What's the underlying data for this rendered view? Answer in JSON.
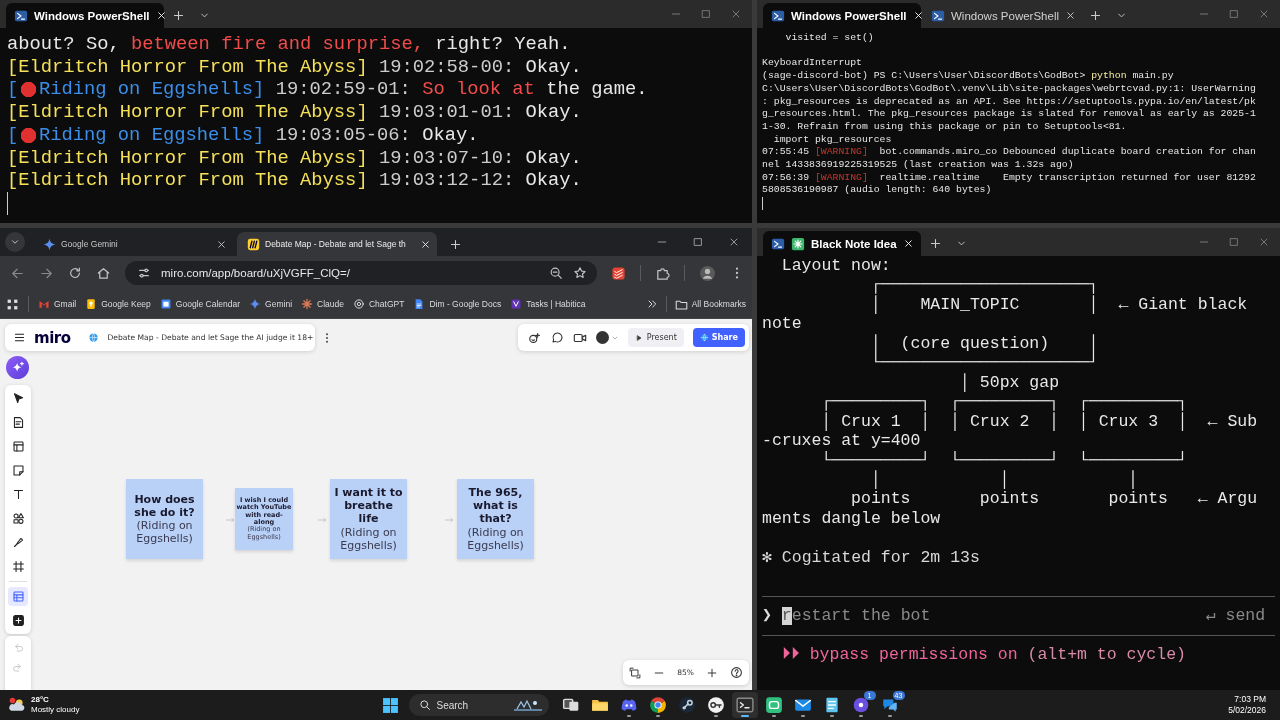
{
  "terminal_left": {
    "tabs": [
      {
        "kind": "shell",
        "label": "Windows PowerShell",
        "selected": true
      }
    ],
    "lines": [
      {
        "segments": [
          {
            "kind": "plain",
            "text": "about? So, "
          },
          {
            "kind": "alert",
            "text": "between fire and surprise,"
          },
          {
            "kind": "plain",
            "text": " right? Yeah."
          }
        ]
      },
      {
        "segments": [
          {
            "kind": "name_a",
            "text": "[Eldritch Horror From The Abyss]"
          },
          {
            "kind": "stamp",
            "text": " 19:02:58-00:"
          },
          {
            "kind": "plain",
            "text": " Okay."
          }
        ]
      },
      {
        "segments": [
          {
            "kind": "name_b",
            "text": "["
          },
          {
            "kind": "dot"
          },
          {
            "kind": "name_b",
            "text": "Riding on Eggshells]"
          },
          {
            "kind": "stamp",
            "text": " 19:02:59-01:"
          },
          {
            "kind": "alert",
            "text": " So look at"
          },
          {
            "kind": "plain",
            "text": " the game."
          }
        ]
      },
      {
        "segments": [
          {
            "kind": "name_a",
            "text": "[Eldritch Horror From The Abyss]"
          },
          {
            "kind": "stamp",
            "text": " 19:03:01-01:"
          },
          {
            "kind": "plain",
            "text": " Okay."
          }
        ]
      },
      {
        "segments": [
          {
            "kind": "name_b",
            "text": "["
          },
          {
            "kind": "dot"
          },
          {
            "kind": "name_b",
            "text": "Riding on Eggshells]"
          },
          {
            "kind": "stamp",
            "text": " 19:03:05-06:"
          },
          {
            "kind": "plain",
            "text": " Okay."
          }
        ]
      },
      {
        "segments": [
          {
            "kind": "name_a",
            "text": "[Eldritch Horror From The Abyss]"
          },
          {
            "kind": "stamp",
            "text": " 19:03:07-10:"
          },
          {
            "kind": "plain",
            "text": " Okay."
          }
        ]
      },
      {
        "segments": [
          {
            "kind": "name_a",
            "text": "[Eldritch Horror From The Abyss]"
          },
          {
            "kind": "stamp",
            "text": " 19:03:12-12:"
          },
          {
            "kind": "plain",
            "text": " Okay."
          }
        ]
      }
    ]
  },
  "terminal_right": {
    "tabs": [
      {
        "kind": "shell",
        "label": "Windows PowerShell",
        "selected": true
      },
      {
        "kind": "shell",
        "label": "Windows PowerShell",
        "selected": false
      }
    ],
    "lines": [
      {
        "segments": [
          {
            "kind": "plain",
            "text": "    visited = set()"
          }
        ]
      },
      {
        "space_before": true,
        "segments": [
          {
            "kind": "plain",
            "text": "KeyboardInterrupt"
          }
        ]
      },
      {
        "segments": [
          {
            "kind": "plain",
            "text": "(sage-discord-bot) PS C:\\Users\\User\\DiscordBots\\GodBot> "
          },
          {
            "kind": "cmd",
            "text": "python"
          },
          {
            "kind": "plain",
            "text": " main.py"
          }
        ]
      },
      {
        "segments": [
          {
            "kind": "plain",
            "text": "C:\\Users\\User\\DiscordBots\\GodBot\\.venv\\Lib\\site-packages\\webrtcvad.py:1: UserWarning"
          }
        ]
      },
      {
        "segments": [
          {
            "kind": "plain",
            "text": ": pkg_resources is deprecated as an API. See https://setuptools.pypa.io/en/latest/pk"
          }
        ]
      },
      {
        "segments": [
          {
            "kind": "plain",
            "text": "g_resources.html. The pkg_resources package is slated for removal as early as 2025-1"
          }
        ]
      },
      {
        "segments": [
          {
            "kind": "plain",
            "text": "1-30. Refrain from using this package or pin to Setuptools<81."
          }
        ]
      },
      {
        "segments": [
          {
            "kind": "plain",
            "text": "  import pkg_resources"
          }
        ]
      },
      {
        "segments": [
          {
            "kind": "plain",
            "text": "07:55:45 "
          },
          {
            "kind": "warn",
            "text": "[WARNING]"
          },
          {
            "kind": "plain",
            "text": "  bot.commands.miro_co Debounced duplicate board creation for chan"
          }
        ]
      },
      {
        "segments": [
          {
            "kind": "plain",
            "text": "nel 1433836919225319525 (last creation was 1.32s ago)"
          }
        ]
      },
      {
        "segments": [
          {
            "kind": "plain",
            "text": "07:56:39 "
          },
          {
            "kind": "warn",
            "text": "[WARNING]"
          },
          {
            "kind": "plain",
            "text": "  realtime.realtime    Empty transcription returned for user 81292"
          }
        ]
      },
      {
        "segments": [
          {
            "kind": "plain",
            "text": "5808536190987 (audio length: 640 bytes)"
          }
        ]
      }
    ]
  },
  "browser": {
    "tabs": [
      {
        "kind": "gemini",
        "title": "Google Gemini",
        "selected": false
      },
      {
        "kind": "miro",
        "title": "Debate Map - Debate and let Sage th",
        "selected": true
      }
    ],
    "url": "miro.com/app/board/uXjVGFF_ClQ=/",
    "bookmarks": [
      {
        "kind": "gmail",
        "label": "Gmail"
      },
      {
        "kind": "keep",
        "label": "Google Keep"
      },
      {
        "kind": "calendar",
        "label": "Google Calendar"
      },
      {
        "kind": "gemini",
        "label": "Gemini"
      },
      {
        "kind": "claude",
        "label": "Claude"
      },
      {
        "kind": "chatgpt",
        "label": "ChatGPT"
      },
      {
        "kind": "docs",
        "label": "Dim - Google Docs"
      },
      {
        "kind": "habitica",
        "label": "Tasks | Habitica"
      }
    ],
    "all_bookmarks": "All Bookmarks",
    "board": {
      "logo": "miro",
      "title": "Debate Map - Debate and let Sage the AI judge it 18+",
      "present": "Present",
      "share": "Share",
      "zoom": "85%",
      "tools": [
        {
          "kind": "select",
          "selected": false
        },
        {
          "kind": "document",
          "selected": false
        },
        {
          "kind": "layout",
          "selected": false
        },
        {
          "kind": "sticky",
          "selected": false
        },
        {
          "kind": "text",
          "selected": false
        },
        {
          "kind": "shapes",
          "selected": false
        },
        {
          "kind": "pen",
          "selected": false
        },
        {
          "kind": "frame",
          "selected": false
        },
        {
          "kind": "table",
          "selected": true
        },
        {
          "kind": "add",
          "selected": false
        }
      ],
      "history": [
        {
          "kind": "undo",
          "disabled": true
        },
        {
          "kind": "redo",
          "disabled": true
        }
      ],
      "notes": [
        {
          "kind": "large",
          "title": "How does she do it?",
          "subtitle": "(Riding on Eggshells)"
        },
        {
          "kind": "small",
          "title": "I wish I could watch YouTube with read-along",
          "subtitle": "(Riding on Eggshells)"
        },
        {
          "kind": "large",
          "title": "I want it to breathe life",
          "subtitle": "(Riding on Eggshells)"
        },
        {
          "kind": "large",
          "title": "The 965, what is that?",
          "subtitle": "(Riding on Eggshells)"
        }
      ]
    }
  },
  "terminal_agent": {
    "tabs": [
      {
        "kind": "agent",
        "label": "Black Note Idea",
        "selected": true
      }
    ],
    "lines": [
      {
        "segments": [
          {
            "kind": "plain",
            "text": "  Layout now:"
          }
        ]
      },
      {
        "segments": [
          {
            "kind": "plain",
            "text": "           ┌─────────────────────┐"
          }
        ]
      },
      {
        "segments": [
          {
            "kind": "plain",
            "text": "           │    MAIN_TOPIC       │  ← Giant black"
          }
        ]
      },
      {
        "segments": [
          {
            "kind": "plain",
            "text": "note"
          }
        ]
      },
      {
        "segments": [
          {
            "kind": "plain",
            "text": "           │  (core question)    │"
          }
        ]
      },
      {
        "segments": [
          {
            "kind": "plain",
            "text": "           └─────────────────────┘"
          }
        ]
      },
      {
        "segments": [
          {
            "kind": "plain",
            "text": "                    │ 50px gap"
          }
        ]
      },
      {
        "segments": [
          {
            "kind": "plain",
            "text": "      ┌─────────┐  ┌─────────┐  ┌─────────┐"
          }
        ]
      },
      {
        "segments": [
          {
            "kind": "plain",
            "text": "      │ Crux 1  │  │ Crux 2  │  │ Crux 3  │  ← Sub"
          }
        ]
      },
      {
        "segments": [
          {
            "kind": "plain",
            "text": "-cruxes at y=400"
          }
        ]
      },
      {
        "segments": [
          {
            "kind": "plain",
            "text": "      └─────────┘  └─────────┘  └─────────┘"
          }
        ]
      },
      {
        "segments": [
          {
            "kind": "plain",
            "text": "           │            │            │"
          }
        ]
      },
      {
        "segments": [
          {
            "kind": "plain",
            "text": "         points       points       points   ← Argu"
          }
        ]
      },
      {
        "segments": [
          {
            "kind": "plain",
            "text": "ments dangle below"
          }
        ]
      },
      {
        "space_before": true,
        "segments": [
          {
            "kind": "muted",
            "text": "✻ Cogitated for 2m 13s"
          }
        ]
      }
    ],
    "prompt": {
      "symbol": "❯",
      "placeholder": "restart the bot",
      "hint": "↵ send"
    },
    "footer": [
      {
        "segments": [
          {
            "kind": "mode",
            "text": "  ⏵⏵ bypass permissions on"
          },
          {
            "kind": "mode_dim",
            "text": " (alt+m to cycle)"
          }
        ]
      }
    ]
  },
  "taskbar": {
    "weather": {
      "temperature": "28°C",
      "condition": "Mostly cloudy"
    },
    "search": "Search",
    "apps": [
      {
        "kind": "taskview",
        "running": false,
        "active": false
      },
      {
        "kind": "explorer",
        "running": false,
        "active": false
      },
      {
        "kind": "discord",
        "running": true,
        "active": false
      },
      {
        "kind": "chrome",
        "running": true,
        "active": false
      },
      {
        "kind": "steam",
        "running": false,
        "active": false
      },
      {
        "kind": "key",
        "running": true,
        "active": false
      },
      {
        "kind": "terminal",
        "running": true,
        "active": true
      },
      {
        "kind": "chat",
        "running": true,
        "active": false
      },
      {
        "kind": "mail",
        "running": true,
        "active": false
      },
      {
        "kind": "notepad",
        "running": true,
        "active": false
      },
      {
        "kind": "disc",
        "running": true,
        "active": false,
        "badge": "1"
      },
      {
        "kind": "bubbles",
        "running": true,
        "active": false,
        "badge": "43"
      }
    ],
    "clock": {
      "time": "7:03 PM",
      "date": "5/02/2026"
    }
  }
}
